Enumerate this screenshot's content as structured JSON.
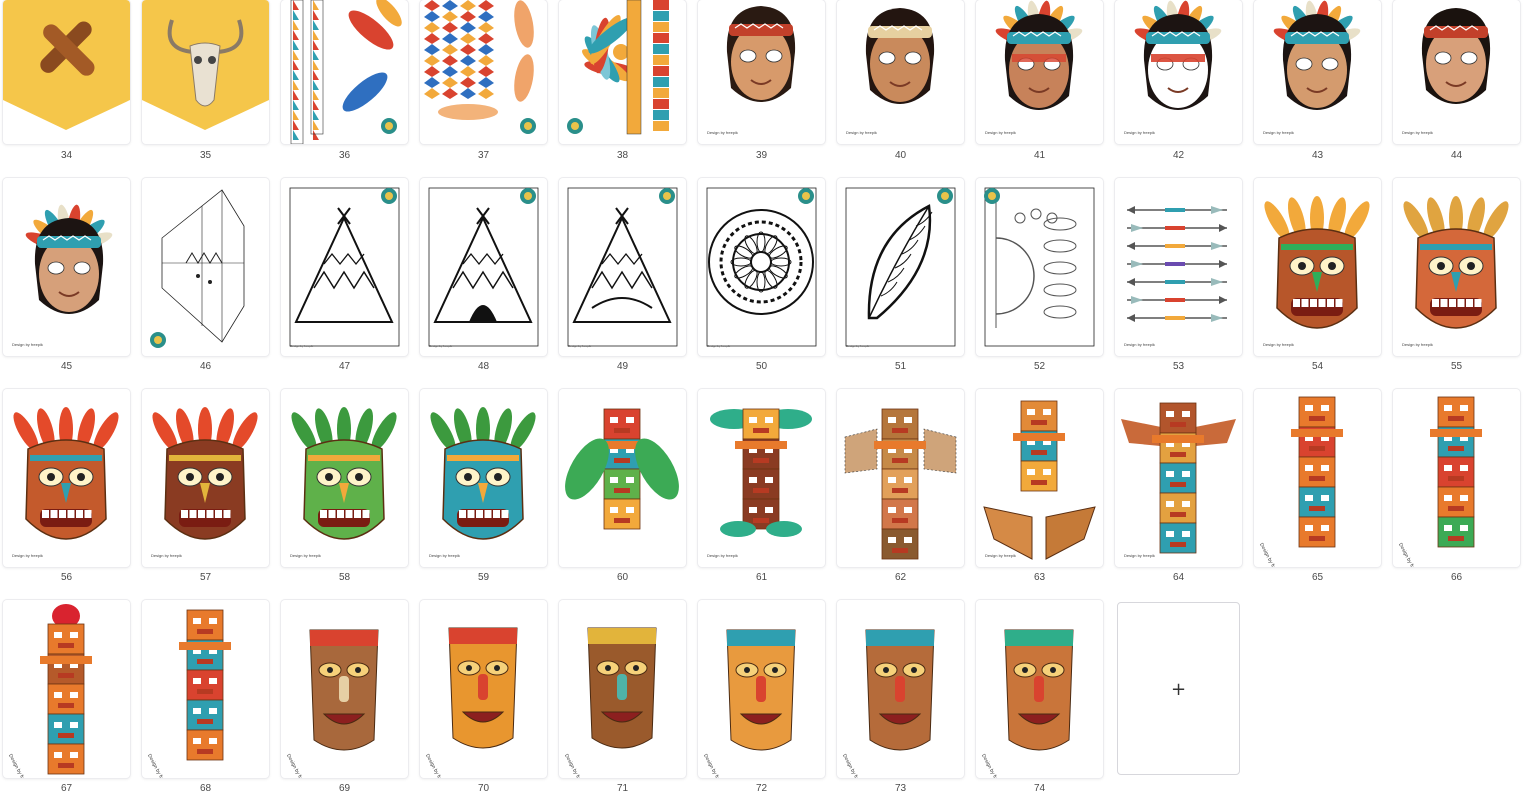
{
  "credit_text": "Design by freepik",
  "add_page": {
    "icon": "plus-icon",
    "glyph": "+"
  },
  "pages": [
    {
      "number": "34",
      "label": "Banner with crossed logs",
      "kind": "banner-logs"
    },
    {
      "number": "35",
      "label": "Banner with bull skull",
      "kind": "banner-skull"
    },
    {
      "number": "36",
      "label": "Feather and pattern strips",
      "kind": "strips-feathers"
    },
    {
      "number": "37",
      "label": "Patterned headband strips",
      "kind": "strips-pattern"
    },
    {
      "number": "38",
      "label": "Feather headdress cutout",
      "kind": "headdress"
    },
    {
      "number": "39",
      "label": "Boy mask",
      "kind": "face-boy"
    },
    {
      "number": "40",
      "label": "Boy mask with headband",
      "kind": "face-boy2"
    },
    {
      "number": "41",
      "label": "Chief mask",
      "kind": "face-chief"
    },
    {
      "number": "42",
      "label": "Headdress mask with braids",
      "kind": "face-headdress"
    },
    {
      "number": "43",
      "label": "Smiling chief mask",
      "kind": "face-chief2"
    },
    {
      "number": "44",
      "label": "Girl mask",
      "kind": "face-girl"
    },
    {
      "number": "45",
      "label": "Side headdress mask",
      "kind": "face-side"
    },
    {
      "number": "46",
      "label": "Teepee cutout outline",
      "kind": "outline-fold"
    },
    {
      "number": "47",
      "label": "Teepee coloring page",
      "kind": "color-teepee1"
    },
    {
      "number": "48",
      "label": "Teepee coloring page 2",
      "kind": "color-teepee2"
    },
    {
      "number": "49",
      "label": "Teepee coloring page 3",
      "kind": "color-teepee3"
    },
    {
      "number": "50",
      "label": "Mandala coloring page",
      "kind": "color-mandala"
    },
    {
      "number": "51",
      "label": "Feather coloring page",
      "kind": "color-feather"
    },
    {
      "number": "52",
      "label": "Dreamcatcher coloring page",
      "kind": "color-dreamcatcher"
    },
    {
      "number": "53",
      "label": "Arrows sheet",
      "kind": "arrows"
    },
    {
      "number": "54",
      "label": "Tiki mask with leaves",
      "kind": "tiki-a"
    },
    {
      "number": "55",
      "label": "Horned tiki mask",
      "kind": "tiki-b"
    },
    {
      "number": "56",
      "label": "Tiki mask",
      "kind": "tiki-c"
    },
    {
      "number": "57",
      "label": "Tiki mask with teeth",
      "kind": "tiki-d"
    },
    {
      "number": "58",
      "label": "Green tiki mask",
      "kind": "tiki-e"
    },
    {
      "number": "59",
      "label": "Leafy tiki mask",
      "kind": "tiki-f"
    },
    {
      "number": "60",
      "label": "Tiki totem with palms",
      "kind": "totem-a"
    },
    {
      "number": "61",
      "label": "Tiki totem with leaves",
      "kind": "totem-b"
    },
    {
      "number": "62",
      "label": "Winged totem cutout",
      "kind": "totem-c"
    },
    {
      "number": "63",
      "label": "Totem with wings cutout",
      "kind": "totem-d"
    },
    {
      "number": "64",
      "label": "Winged totem pole",
      "kind": "totem-e"
    },
    {
      "number": "65",
      "label": "Tall totem pole",
      "kind": "pole-a"
    },
    {
      "number": "66",
      "label": "Tall totem pole 2",
      "kind": "pole-b"
    },
    {
      "number": "67",
      "label": "Totem pole with red crest",
      "kind": "pole-c"
    },
    {
      "number": "68",
      "label": "Stacked totem pole",
      "kind": "pole-d"
    },
    {
      "number": "69",
      "label": "Flat tiki mask",
      "kind": "flat-a"
    },
    {
      "number": "70",
      "label": "Flat tiki mask 2",
      "kind": "flat-b"
    },
    {
      "number": "71",
      "label": "Flat tiki mask 3",
      "kind": "flat-c"
    },
    {
      "number": "72",
      "label": "Flat tiki mask 4",
      "kind": "flat-d"
    },
    {
      "number": "73",
      "label": "Flat tiki mask 5",
      "kind": "flat-e"
    },
    {
      "number": "74",
      "label": "Flat tiki mask 6",
      "kind": "flat-f"
    }
  ]
}
